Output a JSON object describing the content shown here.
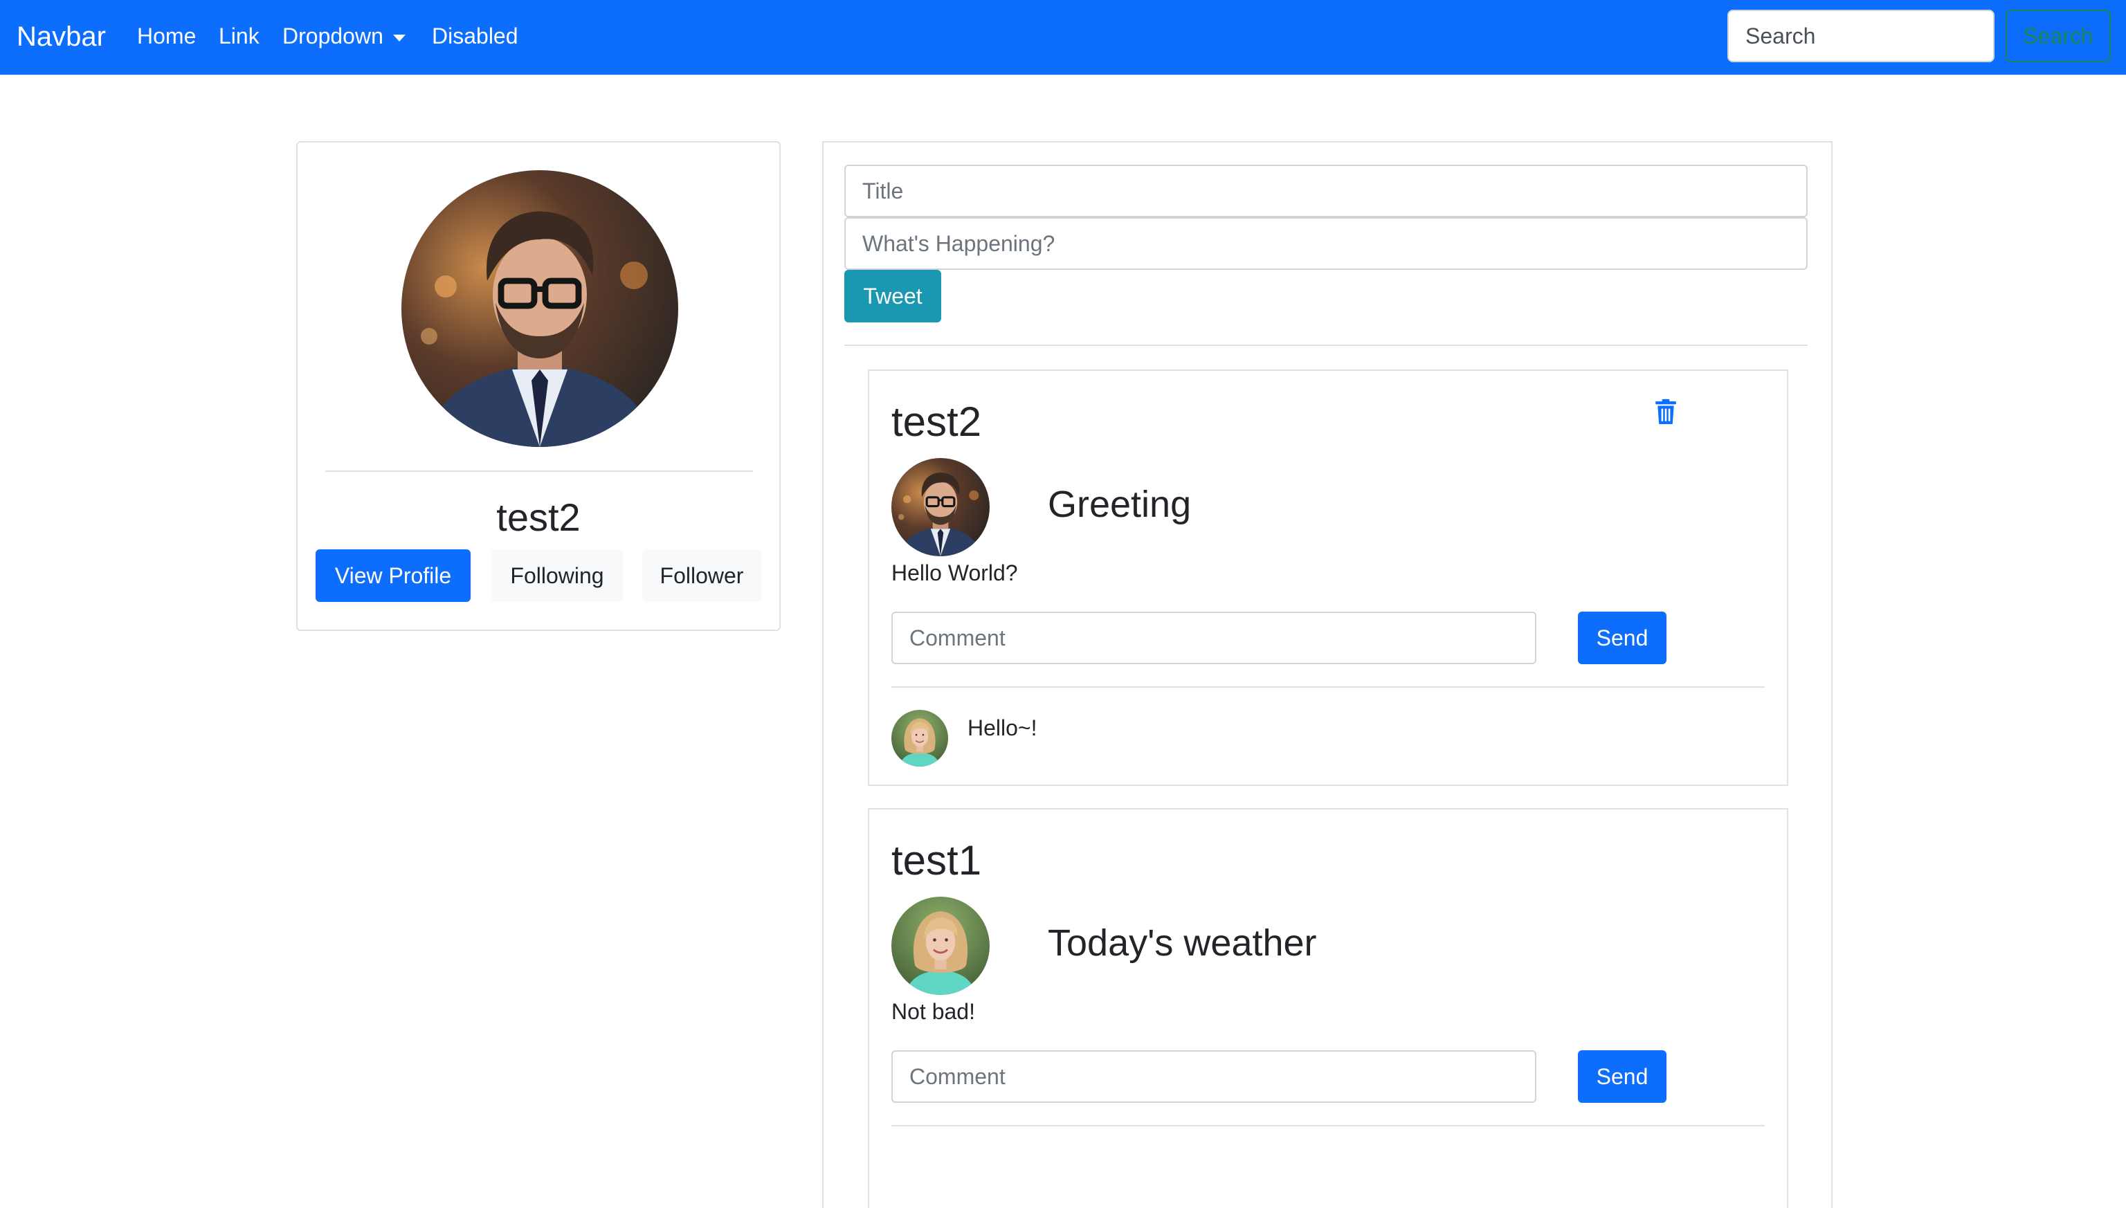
{
  "navbar": {
    "brand": "Navbar",
    "links": [
      "Home",
      "Link",
      "Dropdown",
      "Disabled"
    ],
    "search_placeholder": "Search",
    "search_button": "Search"
  },
  "profile": {
    "name": "test2",
    "buttons": {
      "view_profile": "View Profile",
      "following": "Following",
      "follower": "Follower"
    }
  },
  "composer": {
    "title_placeholder": "Title",
    "body_placeholder": "What's Happening?",
    "tweet_label": "Tweet"
  },
  "posts": [
    {
      "author": "test2",
      "title": "Greeting",
      "body": "Hello World?",
      "comment_placeholder": "Comment",
      "send_label": "Send",
      "comments": [
        {
          "text": "Hello~!"
        }
      ]
    },
    {
      "author": "test1",
      "title": "Today's weather",
      "body": "Not bad!",
      "comment_placeholder": "Comment",
      "send_label": "Send",
      "comments": []
    }
  ],
  "icons": {
    "delete": "trash-icon",
    "dropdown": "caret-down-icon"
  },
  "colors": {
    "navbar": "#0d6efd",
    "primary": "#0d6efd",
    "tweet": "#1b98b1",
    "search_outline": "#198754"
  }
}
